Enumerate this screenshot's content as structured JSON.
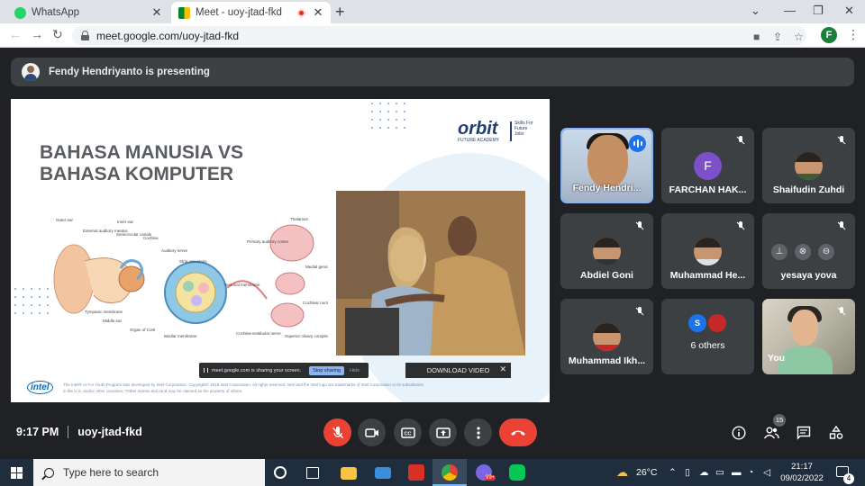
{
  "browser": {
    "tabs": [
      {
        "label": "WhatsApp",
        "active": false
      },
      {
        "label": "Meet - uoy-jtad-fkd",
        "active": true,
        "recording": true
      }
    ],
    "new_tab": "+",
    "url": "meet.google.com/uoy-jtad-fkd",
    "profile_initial": "F",
    "window_controls": {
      "menu": "⌄",
      "minimize": "—",
      "restore": "❐",
      "close": "✕"
    }
  },
  "meet": {
    "presenting_text": "Fendy Hendriyanto is presenting",
    "slide": {
      "title": "BAHASA MANUSIA VS BAHASA KOMPUTER",
      "brand": "orbit",
      "brand_sub": "FUTURE ACADEMY",
      "brand_tag": "Skills For Future Jobs",
      "share_notice": "meet.google.com is sharing your screen.",
      "stop_sharing": "Stop sharing",
      "hide": "Hide",
      "download": "DOWNLOAD VIDEO",
      "download_close": "✕",
      "intel_logo": "intel",
      "legal": "The Intel® AI For Youth Program was developed by Intel Corporation. Copyright© 2019 Intel Corporation. All rights reserved. Intel and the Intel logo are trademarks of Intel Corporation or its subsidiaries in the U.S. and/or other countries. *Other names and rand may be claimed as the property of others."
    },
    "participants": [
      {
        "name": "Fendy Hendri...",
        "type": "video-speaker",
        "speaking": true
      },
      {
        "name": "FARCHAN HAK...",
        "type": "letter",
        "letter": "F",
        "color": "#7d50c9"
      },
      {
        "name": "Shaifudin Zuhdi",
        "type": "photo"
      },
      {
        "name": "Abdiel Goni",
        "type": "photo"
      },
      {
        "name": "Muhammad He...",
        "type": "photo"
      },
      {
        "name": "yesaya yova",
        "type": "hover"
      },
      {
        "name": "Muhammad Ikh...",
        "type": "photo"
      },
      {
        "name": "6 others",
        "type": "others",
        "letter": "S"
      },
      {
        "name": "You",
        "type": "video-self"
      }
    ],
    "time": "9:17 PM",
    "meeting_code": "uoy-jtad-fkd",
    "people_count": "15",
    "accent_red": "#ea4335"
  },
  "taskbar": {
    "search_placeholder": "Type here to search",
    "temperature": "26°C",
    "time": "21:17",
    "date": "09/02/2022",
    "notifications": "4",
    "chrome_badge": "99+"
  }
}
